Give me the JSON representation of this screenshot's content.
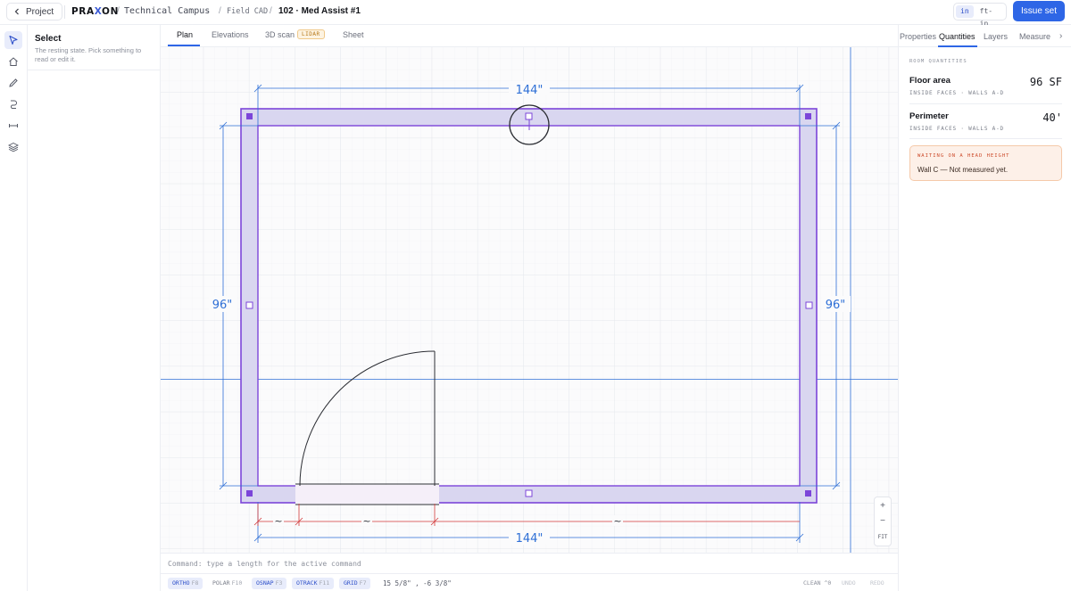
{
  "topbar": {
    "back_label": "Project",
    "logo": {
      "left": "PRA",
      "mark": "X",
      "right": "ON"
    },
    "breadcrumb": {
      "campus": "Technical Campus",
      "section": "Field CAD",
      "room": "102 · Med Assist #1",
      "separator": "/"
    },
    "units": {
      "inch": "in",
      "feet_inch": "ft-in",
      "active": "in"
    },
    "issue_label": "Issue set"
  },
  "tools": [
    "select-tool",
    "home-tool",
    "pen-tool",
    "curve-tool",
    "dimension-tool",
    "layers-tool"
  ],
  "tool_panel": {
    "title": "Select",
    "description": "The resting state. Pick something to read or edit it."
  },
  "view_tabs": {
    "plan": "Plan",
    "elevations": "Elevations",
    "scan": "3D scan",
    "scan_badge": "LIDAR",
    "sheet": "Sheet",
    "active": "Plan"
  },
  "plan": {
    "dim_top": "144\"",
    "dim_bottom": "144\"",
    "dim_left": "96\"",
    "dim_right": "96\"",
    "tilde": "~"
  },
  "zoom": {
    "in": "+",
    "out": "−",
    "fit": "FIT"
  },
  "command": {
    "prompt": "Command: type a length for the active command"
  },
  "status": {
    "ortho": {
      "label": "ORTHO",
      "key": "F8",
      "on": true
    },
    "polar": {
      "label": "POLAR",
      "key": "F10",
      "on": false
    },
    "osnap": {
      "label": "OSNAP",
      "key": "F3",
      "on": true
    },
    "otrack": {
      "label": "OTRACK",
      "key": "F11",
      "on": true
    },
    "grid": {
      "label": "GRID",
      "key": "F7",
      "on": true
    },
    "coords": "15 5/8\" , -6 3/8\"",
    "clean": "CLEAN ^0",
    "undo": "UNDO",
    "redo": "REDO"
  },
  "right_tabs": {
    "properties": "Properties",
    "quantities": "Quantities",
    "layers": "Layers",
    "measure": "Measure",
    "more": "›",
    "active": "Quantities"
  },
  "quantities": {
    "section_title": "ROOM QUANTITIES",
    "floor_area": {
      "label": "Floor area",
      "sub": "INSIDE FACES · WALLS A-D",
      "value": "96 SF"
    },
    "perimeter": {
      "label": "Perimeter",
      "sub": "INSIDE FACES · WALLS A-D",
      "value": "40'"
    }
  },
  "alert": {
    "title": "WAITING ON A HEAD HEIGHT",
    "text": "Wall C — Not measured yet."
  },
  "colors": {
    "accent": "#2e66e6",
    "wall": "#7c45d9",
    "wall_fill": "#d9d6f0",
    "dimension": "#2e6fd6",
    "error_dimension": "#d33a3a",
    "warning_bg": "#fdf0e8"
  }
}
